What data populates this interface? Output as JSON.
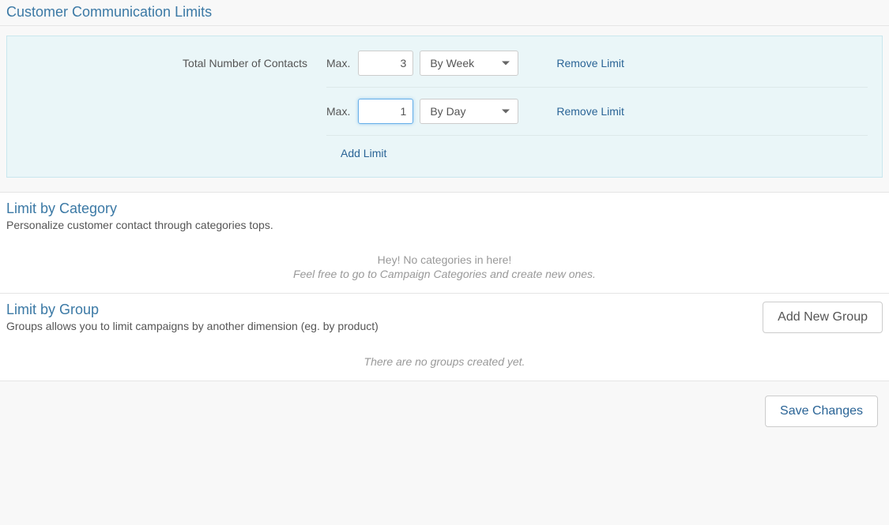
{
  "header": {
    "title": "Customer Communication Limits"
  },
  "totalContacts": {
    "label": "Total Number of Contacts",
    "maxLabel": "Max.",
    "rows": [
      {
        "value": "3",
        "period": "By Week",
        "removeLabel": "Remove Limit",
        "focused": false
      },
      {
        "value": "1",
        "period": "By Day",
        "removeLabel": "Remove Limit",
        "focused": true
      }
    ],
    "addLabel": "Add Limit"
  },
  "category": {
    "title": "Limit by Category",
    "description": "Personalize customer contact through categories tops.",
    "emptyLine1": "Hey! No categories in here!",
    "emptyLine2": "Feel free to go to Campaign Categories and create new ones."
  },
  "group": {
    "title": "Limit by Group",
    "description": "Groups allows you to limit campaigns by another dimension (eg. by product)",
    "addButton": "Add New Group",
    "empty": "There are no groups created yet."
  },
  "footer": {
    "saveLabel": "Save Changes"
  }
}
